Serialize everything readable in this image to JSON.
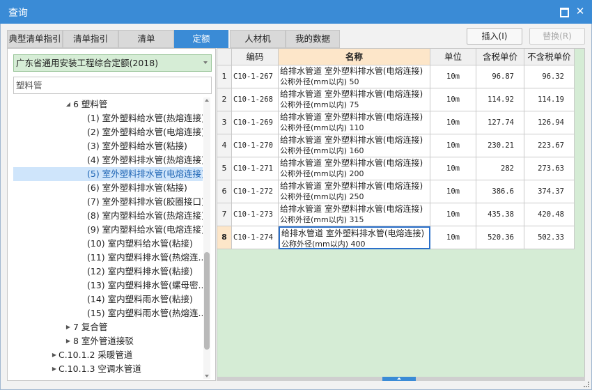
{
  "window": {
    "title": "查询"
  },
  "tabs": [
    {
      "label": "典型清单指引"
    },
    {
      "label": "清单指引"
    },
    {
      "label": "清单"
    },
    {
      "label": "定额"
    },
    {
      "label": "人材机"
    },
    {
      "label": "我的数据"
    }
  ],
  "active_tab_index": 3,
  "buttons": {
    "insert": "插入(I)",
    "replace": "替换(R)"
  },
  "left": {
    "selector": "广东省通用安装工程综合定额(2018)",
    "search_value": "塑料管",
    "tree": [
      {
        "label": "6 塑料管",
        "expanded": true,
        "depth": 1
      },
      {
        "label": "(1) 室外塑料给水管(热熔连接)",
        "depth": 2
      },
      {
        "label": "(2) 室外塑料给水管(电熔连接)",
        "depth": 2
      },
      {
        "label": "(3) 室外塑料给水管(粘接)",
        "depth": 2
      },
      {
        "label": "(4) 室外塑料排水管(热熔连接)",
        "depth": 2
      },
      {
        "label": "(5) 室外塑料排水管(电熔连接)",
        "depth": 2,
        "selected": true
      },
      {
        "label": "(6) 室外塑料排水管(粘接)",
        "depth": 2
      },
      {
        "label": "(7) 室外塑料排水管(胶圈接口)",
        "depth": 2
      },
      {
        "label": "(8) 室内塑料给水管(热熔连接)",
        "depth": 2
      },
      {
        "label": "(9) 室内塑料给水管(电熔连接)",
        "depth": 2
      },
      {
        "label": "(10) 室内塑料给水管(粘接)",
        "depth": 2
      },
      {
        "label": "(11) 室内塑料排水管(热熔连...",
        "depth": 2
      },
      {
        "label": "(12) 室内塑料排水管(粘接)",
        "depth": 2
      },
      {
        "label": "(13) 室内塑料排水管(螺母密...",
        "depth": 2
      },
      {
        "label": "(14) 室内塑料雨水管(粘接)",
        "depth": 2
      },
      {
        "label": "(15) 室内塑料雨水管(热熔连...",
        "depth": 2
      },
      {
        "label": "7 复合管",
        "expanded": false,
        "depth": 1
      },
      {
        "label": "8 室外管道接驳",
        "expanded": false,
        "depth": 1
      },
      {
        "label": "C.10.1.2 采暖管道",
        "expanded": false,
        "depth": 0
      },
      {
        "label": "C.10.1.3 空调水管道",
        "expanded": false,
        "depth": 0
      }
    ]
  },
  "grid": {
    "headers": {
      "code": "编码",
      "name": "名称",
      "unit": "单位",
      "price_tax": "含税单价",
      "price_notax": "不含税单价"
    },
    "rows": [
      {
        "no": "1",
        "code": "C10-1-267",
        "name1": "给排水管道 室外塑料排水管(电熔连接)",
        "name2": "公称外径(mm以内) 50",
        "unit": "10m",
        "price_tax": "96.87",
        "price_notax": "96.32"
      },
      {
        "no": "2",
        "code": "C10-1-268",
        "name1": "给排水管道 室外塑料排水管(电熔连接)",
        "name2": "公称外径(mm以内) 75",
        "unit": "10m",
        "price_tax": "114.92",
        "price_notax": "114.19"
      },
      {
        "no": "3",
        "code": "C10-1-269",
        "name1": "给排水管道 室外塑料排水管(电熔连接)",
        "name2": "公称外径(mm以内) 110",
        "unit": "10m",
        "price_tax": "127.74",
        "price_notax": "126.94"
      },
      {
        "no": "4",
        "code": "C10-1-270",
        "name1": "给排水管道 室外塑料排水管(电熔连接)",
        "name2": "公称外径(mm以内) 160",
        "unit": "10m",
        "price_tax": "230.21",
        "price_notax": "223.67"
      },
      {
        "no": "5",
        "code": "C10-1-271",
        "name1": "给排水管道 室外塑料排水管(电熔连接)",
        "name2": "公称外径(mm以内) 200",
        "unit": "10m",
        "price_tax": "282",
        "price_notax": "273.63"
      },
      {
        "no": "6",
        "code": "C10-1-272",
        "name1": "给排水管道 室外塑料排水管(电熔连接)",
        "name2": "公称外径(mm以内) 250",
        "unit": "10m",
        "price_tax": "386.6",
        "price_notax": "374.37"
      },
      {
        "no": "7",
        "code": "C10-1-273",
        "name1": "给排水管道 室外塑料排水管(电熔连接)",
        "name2": "公称外径(mm以内) 315",
        "unit": "10m",
        "price_tax": "435.38",
        "price_notax": "420.48"
      },
      {
        "no": "8",
        "code": "C10-1-274",
        "name1": "给排水管道 室外塑料排水管(电熔连接)",
        "name2": "公称外径(mm以内) 400",
        "unit": "10m",
        "price_tax": "520.36",
        "price_notax": "502.33"
      }
    ],
    "current_row_index": 7
  },
  "colors": {
    "accent": "#3a8bd6",
    "grid_bg": "#d5ecd5",
    "header_highlight": "#fde6c9",
    "selection": "#cfe5fb"
  }
}
